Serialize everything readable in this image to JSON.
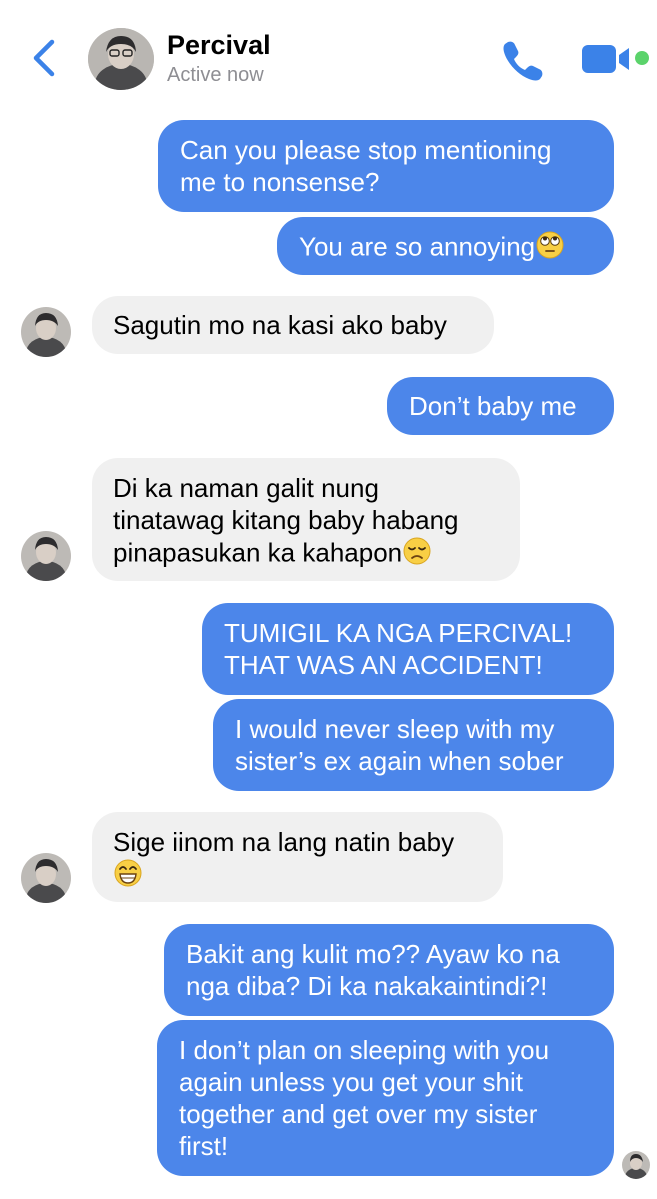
{
  "header": {
    "name": "Percival",
    "status": "Active now",
    "back_icon": "chevron-left-icon",
    "call_icon": "phone-icon",
    "video_icon": "video-camera-icon",
    "accent_color": "#3b82e8",
    "online_color": "#5bd36b"
  },
  "messages": [
    {
      "sender": "me",
      "lines": [
        "Can you please stop mentioning",
        "me to nonsense?"
      ]
    },
    {
      "sender": "me",
      "lines": [
        "You are so annoying"
      ],
      "emoji": "eye-roll-emoji"
    },
    {
      "sender": "Percival",
      "lines": [
        "Sagutin mo na kasi ako baby"
      ]
    },
    {
      "sender": "me",
      "lines": [
        "Don’t baby me"
      ]
    },
    {
      "sender": "Percival",
      "lines": [
        "Di ka naman galit nung",
        "tinatawag kitang baby habang",
        "pinapasukan ka kahapon"
      ],
      "emoji": "disappointed-face-emoji"
    },
    {
      "sender": "me",
      "lines": [
        "TUMIGIL KA NGA PERCIVAL!",
        "THAT WAS AN ACCIDENT!"
      ]
    },
    {
      "sender": "me",
      "lines": [
        "I would never sleep with my",
        "sister’s ex again when sober"
      ]
    },
    {
      "sender": "Percival",
      "lines": [
        "Sige iinom na lang natin baby"
      ],
      "emoji": "grinning-face-emoji"
    },
    {
      "sender": "me",
      "lines": [
        "Bakit ang kulit mo?? Ayaw ko na",
        "nga diba? Di ka nakakaintindi?!"
      ]
    },
    {
      "sender": "me",
      "lines": [
        "I don’t plan on sleeping with you",
        "again unless you get your shit",
        "together and get over my sister",
        "first!"
      ]
    }
  ],
  "colors": {
    "outgoing_bubble": "#4c86ea",
    "incoming_bubble": "#f0f0f0"
  }
}
